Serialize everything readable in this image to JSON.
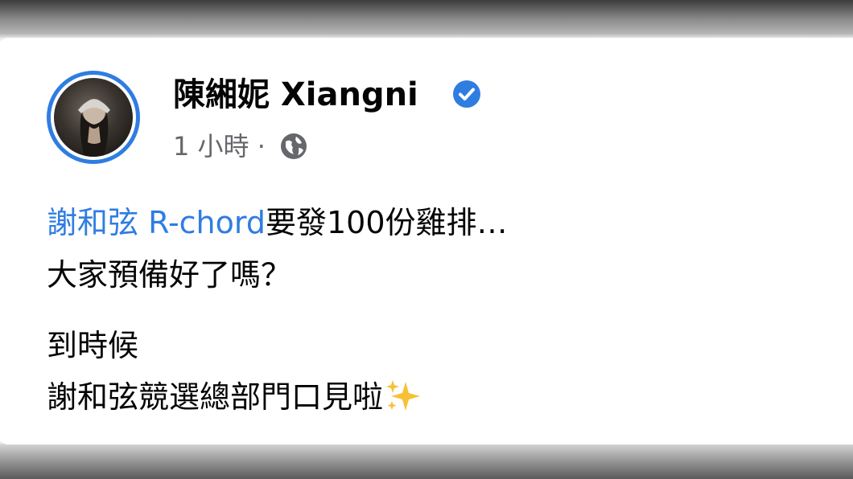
{
  "post": {
    "author": "陳緗妮 Xiangni",
    "timestamp": "1 小時",
    "separator": " · ",
    "mention": "謝和弦 R-chord",
    "line1_rest": "要發100份雞排…",
    "line2": "大家預備好了嗎？",
    "line3": "到時候",
    "line4": "謝和弦競選總部門口見啦"
  },
  "icons": {
    "verified": "verified-badge-icon",
    "audience": "globe-icon",
    "emoji": "sparkles-emoji"
  },
  "colors": {
    "accent": "#2f7de1",
    "text": "#050505",
    "meta": "#65676b"
  }
}
